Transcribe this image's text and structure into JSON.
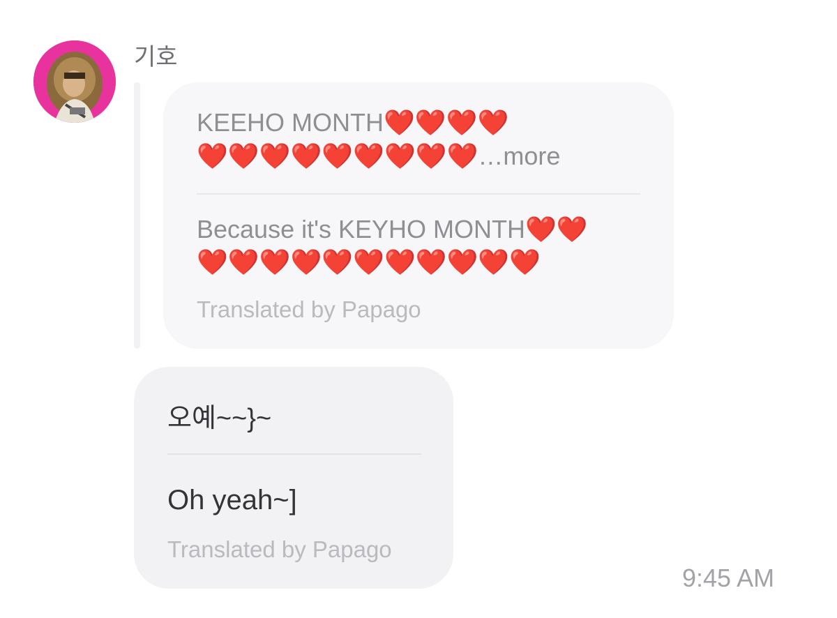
{
  "sender": {
    "name": "기호",
    "avatar_icon": "profile-photo-avatar"
  },
  "quoted_message": {
    "original_line1": "KEEHO MONTH❤️❤️❤️❤️",
    "original_line2": "❤️❤️❤️❤️❤️❤️❤️❤️❤️",
    "more_label": "…more",
    "translated_line1": "Because it's KEYHO MONTH❤️❤️",
    "translated_line2": "❤️❤️❤️❤️❤️❤️❤️❤️❤️❤️❤️",
    "translated_by": "Translated by Papago"
  },
  "message": {
    "original": "오예~~}~",
    "translated": "Oh yeah~]",
    "translated_by": "Translated by Papago"
  },
  "timestamp": "9:45 AM",
  "colors": {
    "avatar_bg": "#e8339f",
    "bubble_bg": "#f2f2f5",
    "quoted_bubble_bg": "#f7f7f9",
    "heart": "#e8101a"
  }
}
